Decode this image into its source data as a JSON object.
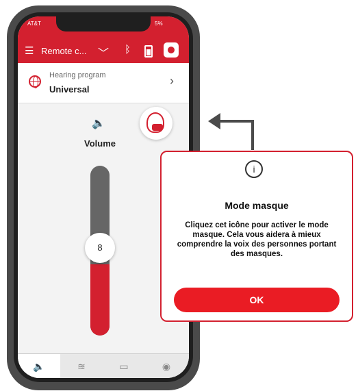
{
  "status": {
    "carrier": "AT&T",
    "battery": "5%"
  },
  "navbar": {
    "title": "Remote c..."
  },
  "program": {
    "label": "Hearing program",
    "value": "Universal"
  },
  "volume": {
    "label": "Volume",
    "value": "8",
    "level_fraction": 0.42
  },
  "popup": {
    "title": "Mode masque",
    "text": "Cliquez cet icône pour activer le mode masque.  Cela vous aidera à mieux comprendre la voix des personnes portant des masques.",
    "ok_label": "OK"
  },
  "colors": {
    "accent": "#d3202f",
    "ok_button": "#ea1c24"
  },
  "icons": {
    "menu": "hamburger-icon",
    "chevron": "chevron-down-icon",
    "bluetooth": "bluetooth-icon",
    "battery": "battery-icon",
    "face": "face-icon",
    "globe": "globe-icon",
    "speaker": "speaker-icon",
    "mask": "mask-icon",
    "info": "info-icon"
  }
}
